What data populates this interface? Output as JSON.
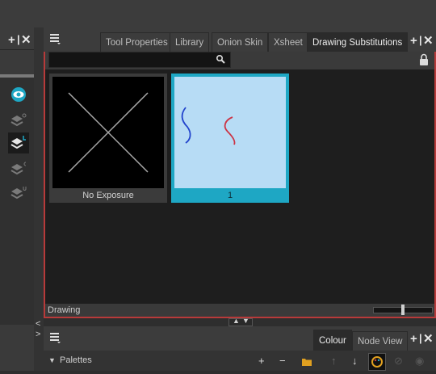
{
  "view": {
    "tabs": [
      {
        "label": "Tool Properties"
      },
      {
        "label": "Library"
      },
      {
        "label": "Onion Skin"
      },
      {
        "label": "Xsheet"
      },
      {
        "label": "Drawing Substitutions"
      }
    ],
    "active_tab": "Drawing Substitutions",
    "search": {
      "value": "",
      "placeholder": ""
    },
    "thumbnails": [
      {
        "label": "No Exposure",
        "selected": false
      },
      {
        "label": "1",
        "selected": true
      }
    ],
    "status_label": "Drawing",
    "zoom_level": 0.5
  },
  "bottom": {
    "tabs": [
      {
        "label": "Colour"
      },
      {
        "label": "Node View"
      }
    ],
    "palettes_label": "Palettes"
  },
  "left": {
    "layer_buttons": [
      "eye-icon",
      "onion-layer-o-icon",
      "onion-layer-l-icon",
      "onion-layer-c-icon",
      "onion-layer-u-icon"
    ]
  },
  "colors": {
    "accent": "#1ea7c4",
    "selected_thumb_bg": "#b7dcf5",
    "frame_border": "#b83a3a"
  }
}
